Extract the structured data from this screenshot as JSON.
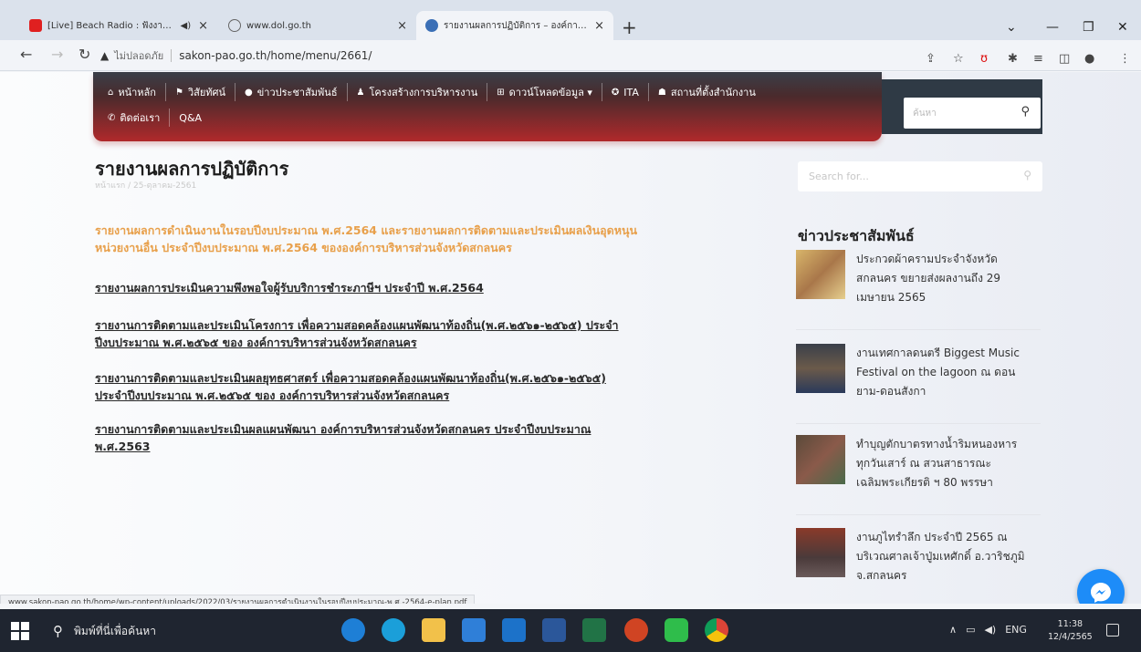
{
  "browser": {
    "tabs": [
      {
        "title": "[Live] Beach Radio : ฟังงาน ก"
      },
      {
        "title": "www.dol.go.th"
      },
      {
        "title": "รายงานผลการปฏิบัติการ – องค์การบริ"
      }
    ],
    "address": {
      "security_label": "ไม่ปลอดภัย",
      "url": "sakon-pao.go.th/home/menu/2661/"
    },
    "status_url": "www.sakon-pao.go.th/home/wp-content/uploads/2022/03/รายงานผลการดำเนินงานในรอบปีงบประมาณ-พ.ศ.-2564-e-plan.pdf"
  },
  "site": {
    "menu": [
      {
        "label": "หน้าหลัก",
        "icon": "home-icon"
      },
      {
        "label": "วิสัยทัศน์",
        "icon": "flag-icon"
      },
      {
        "label": "ข่าวประชาสัมพันธ์",
        "icon": "info-icon"
      },
      {
        "label": "โครงสร้างการบริหารงาน",
        "icon": "user-icon"
      },
      {
        "label": "ดาวน์โหลดข้อมูล ▾",
        "icon": "sitemap-icon"
      },
      {
        "label": "ITA",
        "icon": "award-icon"
      },
      {
        "label": "สถานที่ตั้งสำนักงาน",
        "icon": "thumbs-up-icon"
      },
      {
        "label": "ติดต่อเรา",
        "icon": "phone-icon"
      },
      {
        "label": "Q&A",
        "icon": ""
      }
    ],
    "header_search_placeholder": "ค้นหา"
  },
  "content": {
    "title": "รายงานผลการปฏิบัติการ",
    "breadcrumb": "หน้าแรก / 25-ตุลาคม-2561",
    "documents": [
      {
        "text": "รายงานผลการดำเนินงานในรอบปีงบประมาณ พ.ศ.2564 และรายงานผลการติดตามและประเมินผลเงินอุดหนุน",
        "text2": "หน่วยงานอื่น ประจำปีงบประมาณ พ.ศ.2564 ขององค์การบริหารส่วนจังหวัดสกลนคร"
      },
      {
        "text": "รายงานผลการประเมินความพึงพอใจผู้รับบริการชำระภาษีฯ ประจำปี พ.ศ.2564"
      },
      {
        "text": "รายงานการติดตามและประเมินโครงการ เพื่อความสอดคล้องแผนพัฒนาท้องถิ่น(พ.ศ.๒๕๖๑-๒๕๖๕) ประจำ",
        "text2": "ปีงบประมาณ พ.ศ.๒๕๖๕ ของ องค์การบริหารส่วนจังหวัดสกลนคร"
      },
      {
        "text": "รายงานการติดตามและประเมินผลยุทธศาสตร์ เพื่อความสอดคล้องแผนพัฒนาท้องถิ่น(พ.ศ.๒๕๖๑-๒๕๖๕)",
        "text2": "ประจำปีงบประมาณ พ.ศ.๒๕๖๕ ของ องค์การบริหารส่วนจังหวัดสกลนคร"
      },
      {
        "text": "รายงานการติดตามและประเมินผลแผนพัฒนา องค์การบริหารส่วนจังหวัดสกลนคร ประจำปีงบประมาณ",
        "text2": "พ.ศ.2563"
      }
    ]
  },
  "sidebar": {
    "search_placeholder": "Search for...",
    "news_heading": "ข่าวประชาสัมพันธ์",
    "news": [
      {
        "line1": "ประกวดผ้าครามประจำจังหวัด",
        "line2": "สกลนคร ขยายส่งผลงานถึง 29",
        "line3": "เมษายน 2565"
      },
      {
        "line1": "งานเทศกาลดนตรี Biggest Music",
        "line2": "Festival on the lagoon ณ ดอน",
        "line3": "ยาม-ดอนสังกา"
      },
      {
        "line1": "ทำบุญตักบาตรทางน้ำริมหนองหาร",
        "line2": "ทุกวันเสาร์ ณ สวนสาธารณะ",
        "line3": "เฉลิมพระเกียรติ ฯ 80 พรรษา"
      },
      {
        "line1": "งานภูไทรำลึก ประจำปี 2565 ณ",
        "line2": "บริเวณศาลเจ้าปู่มเหศักดิ์ อ.วาริชภูมิ",
        "line3": "จ.สกลนคร"
      }
    ]
  },
  "taskbar": {
    "search_placeholder": "พิมพ์ที่นี่เพื่อค้นหา",
    "language": "ENG",
    "time": "11:38",
    "date": "12/4/2565"
  },
  "colors": {
    "menu_red": "#b0292b",
    "doc_orange": "#e8a04b",
    "messenger_blue": "#1d8cf8"
  }
}
